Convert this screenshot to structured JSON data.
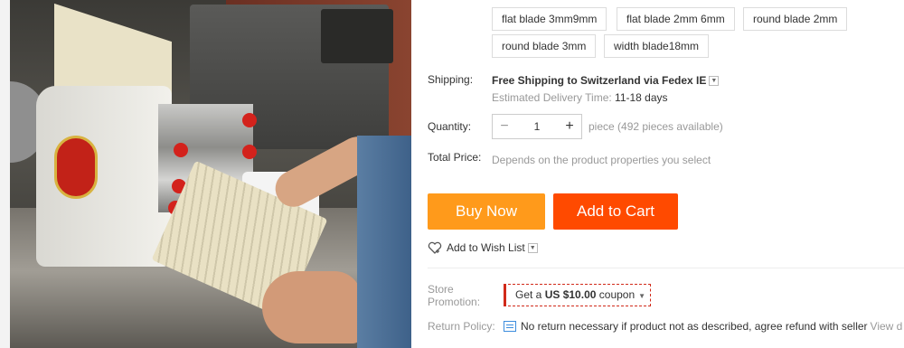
{
  "sku": {
    "options": [
      {
        "label": "flat blade 3mm9mm"
      },
      {
        "label": "flat blade 2mm 6mm"
      },
      {
        "label": "round blade 2mm"
      },
      {
        "label": "round blade 3mm"
      },
      {
        "label": "width blade18mm"
      }
    ]
  },
  "shipping": {
    "label": "Shipping:",
    "method": "Free Shipping to Switzerland via Fedex IE",
    "dropdown_icon": "chevron-down-icon",
    "estimate_label": "Estimated Delivery Time:",
    "estimate_value": "11-18 days"
  },
  "quantity": {
    "label": "Quantity:",
    "minus": "−",
    "value": "1",
    "plus": "+",
    "available": "piece (492 pieces available)"
  },
  "total": {
    "label": "Total Price:",
    "note": "Depends on the product properties you select"
  },
  "actions": {
    "buy_now": "Buy Now",
    "add_to_cart": "Add to Cart",
    "wishlist": "Add to Wish List"
  },
  "store_promotion": {
    "label": "Store Promotion:",
    "coupon_prefix": "Get a",
    "coupon_amount": "US $10.00",
    "coupon_suffix": "coupon"
  },
  "return_policy": {
    "label": "Return Policy:",
    "text": "No return necessary if product not as described, agree refund with seller",
    "more": "View d"
  },
  "colors": {
    "buy_now": "#ff9a1b",
    "add_to_cart": "#ff4a00",
    "coupon_accent": "#d12a1a"
  }
}
